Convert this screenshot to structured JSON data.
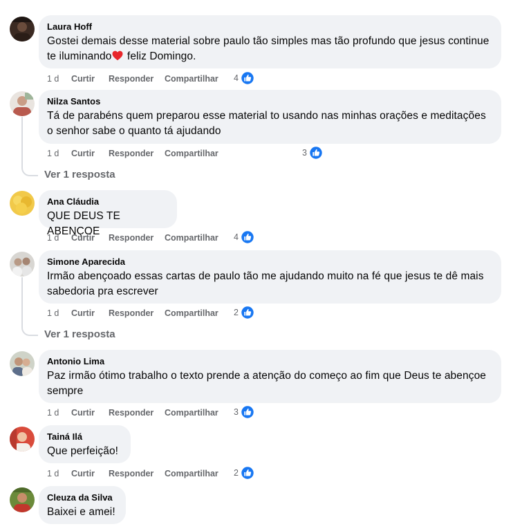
{
  "comments": [
    {
      "author": "Laura Hoff",
      "text_before": "Gostei demais desse material sobre paulo tão simples mas tão profundo que jesus continue te iluminando",
      "emoji": "red-heart-icon",
      "text_after": " feliz Domingo.",
      "time": "1 d",
      "like": "Curtir",
      "reply": "Responder",
      "share": "Compartilhar",
      "reaction_count": "4"
    },
    {
      "author": "Nilza Santos",
      "text": "Tá de parabéns quem preparou esse material to usando nas minhas orações e meditações o senhor sabe o quanto tá ajudando",
      "time": "1 d",
      "like": "Curtir",
      "reply": "Responder",
      "share": "Compartilhar",
      "reaction_count": "3",
      "replies_label": "Ver 1 resposta"
    },
    {
      "author": "Ana Cláudia",
      "text": "QUE DEUS TE ABENÇOE",
      "time": "1 d",
      "like": "Curtir",
      "reply": "Responder",
      "share": "Compartilhar",
      "reaction_count": "4"
    },
    {
      "author": "Simone Aparecida",
      "text": "Irmão abençoado essas cartas de paulo tão me ajudando muito na fé que jesus te dê mais sabedoria pra escrever",
      "time": "1 d",
      "like": "Curtir",
      "reply": "Responder",
      "share": "Compartilhar",
      "reaction_count": "2",
      "replies_label": "Ver 1 resposta"
    },
    {
      "author": "Antonio Lima",
      "text": "Paz irmão ótimo trabalho o texto prende a atenção do começo ao fim que Deus te abençoe sempre",
      "time": "1 d",
      "like": "Curtir",
      "reply": "Responder",
      "share": "Compartilhar",
      "reaction_count": "3"
    },
    {
      "author": "Tainá Ilá",
      "text": "Que perfeição!",
      "time": "1 d",
      "like": "Curtir",
      "reply": "Responder",
      "share": "Compartilhar",
      "reaction_count": "2"
    },
    {
      "author": "Cleuza da Silva",
      "text": "Baixei e amei!"
    }
  ],
  "colors": {
    "bubble": "#f0f2f5",
    "secondary_text": "#65676b",
    "like_blue": "#1877f2",
    "heart_red": "#e8262b"
  }
}
